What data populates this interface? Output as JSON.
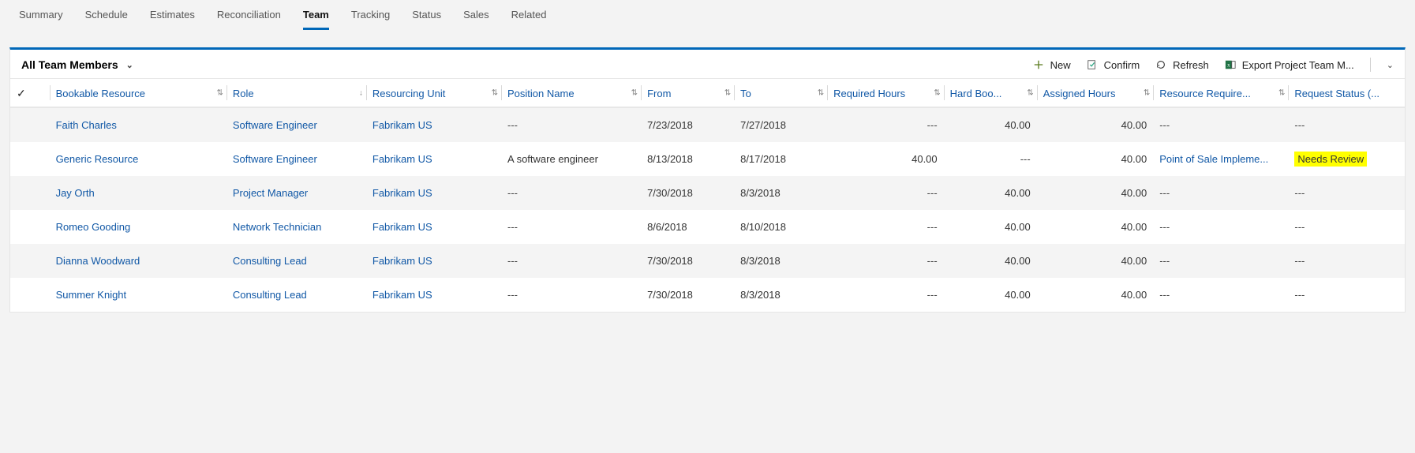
{
  "tabs": {
    "items": [
      "Summary",
      "Schedule",
      "Estimates",
      "Reconciliation",
      "Team",
      "Tracking",
      "Status",
      "Sales",
      "Related"
    ],
    "active_index": 4
  },
  "view": {
    "title": "All Team Members"
  },
  "commands": {
    "new": "New",
    "confirm": "Confirm",
    "refresh": "Refresh",
    "export": "Export Project Team M..."
  },
  "columns": {
    "bookable_resource": "Bookable Resource",
    "role": "Role",
    "resourcing_unit": "Resourcing Unit",
    "position_name": "Position Name",
    "from": "From",
    "to": "To",
    "required_hours": "Required Hours",
    "hard_booked": "Hard Boo...",
    "assigned_hours": "Assigned Hours",
    "resource_req": "Resource Require...",
    "request_status": "Request Status (..."
  },
  "rows": [
    {
      "resource": "Faith Charles",
      "role": "Software Engineer",
      "unit": "Fabrikam US",
      "position": "---",
      "from": "7/23/2018",
      "to": "7/27/2018",
      "required": "---",
      "hard": "40.00",
      "assigned": "40.00",
      "req": "---",
      "status": "---"
    },
    {
      "resource": "Generic Resource",
      "role": "Software Engineer",
      "unit": "Fabrikam US",
      "position": "A software engineer",
      "from": "8/13/2018",
      "to": "8/17/2018",
      "required": "40.00",
      "hard": "---",
      "assigned": "40.00",
      "req": "Point of Sale Impleme...",
      "status": "Needs Review",
      "status_highlight": true,
      "req_link": true
    },
    {
      "resource": "Jay Orth",
      "role": "Project Manager",
      "unit": "Fabrikam US",
      "position": "---",
      "from": "7/30/2018",
      "to": "8/3/2018",
      "required": "---",
      "hard": "40.00",
      "assigned": "40.00",
      "req": "---",
      "status": "---"
    },
    {
      "resource": "Romeo Gooding",
      "role": "Network Technician",
      "unit": "Fabrikam US",
      "position": "---",
      "from": "8/6/2018",
      "to": "8/10/2018",
      "required": "---",
      "hard": "40.00",
      "assigned": "40.00",
      "req": "---",
      "status": "---"
    },
    {
      "resource": "Dianna Woodward",
      "role": "Consulting Lead",
      "unit": "Fabrikam US",
      "position": "---",
      "from": "7/30/2018",
      "to": "8/3/2018",
      "required": "---",
      "hard": "40.00",
      "assigned": "40.00",
      "req": "---",
      "status": "---"
    },
    {
      "resource": "Summer Knight",
      "role": "Consulting Lead",
      "unit": "Fabrikam US",
      "position": "---",
      "from": "7/30/2018",
      "to": "8/3/2018",
      "required": "---",
      "hard": "40.00",
      "assigned": "40.00",
      "req": "---",
      "status": "---"
    }
  ]
}
